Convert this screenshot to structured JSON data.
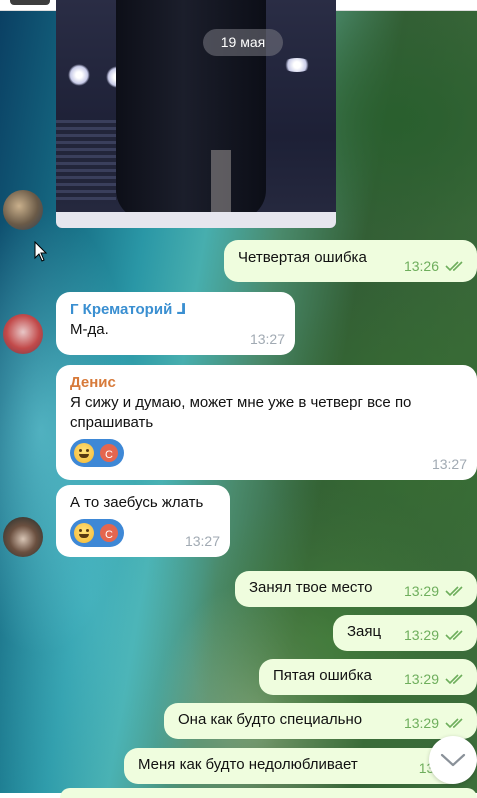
{
  "date_pill": "19 мая",
  "messages": [
    {
      "text": "Четвертая ошибка",
      "time": "13:26",
      "dir": "out"
    },
    {
      "sender": "Г Крематорий ⅃",
      "text": "М-да.",
      "time": "13:27",
      "dir": "in"
    },
    {
      "sender": "Денис",
      "text": "Я сижу и думаю, может мне уже в четверг все по спрашивать",
      "time": "13:27",
      "dir": "in",
      "reaction_initial": "С"
    },
    {
      "text": "А то заебусь жлать",
      "time": "13:27",
      "dir": "in",
      "reaction_initial": "С"
    },
    {
      "text": "Занял твое место",
      "time": "13:29",
      "dir": "out"
    },
    {
      "text": "Заяц",
      "time": "13:29",
      "dir": "out"
    },
    {
      "text": "Пятая ошибка",
      "time": "13:29",
      "dir": "out"
    },
    {
      "text": "Она как будто специально",
      "time": "13:29",
      "dir": "out"
    },
    {
      "text": "Меня как будто недолюбливает",
      "time": "13:3",
      "dir": "out"
    }
  ],
  "colors": {
    "outgoing_bubble": "#effdde",
    "incoming_bubble": "#ffffff",
    "check_green": "#6eae5c",
    "sender_blue": "#3a8fd1",
    "sender_orange": "#d77a3a"
  },
  "icons": {
    "read_receipt": "double-check-icon",
    "scroll_down": "chevron-down-icon",
    "reaction": "grinning-emoji-icon"
  }
}
